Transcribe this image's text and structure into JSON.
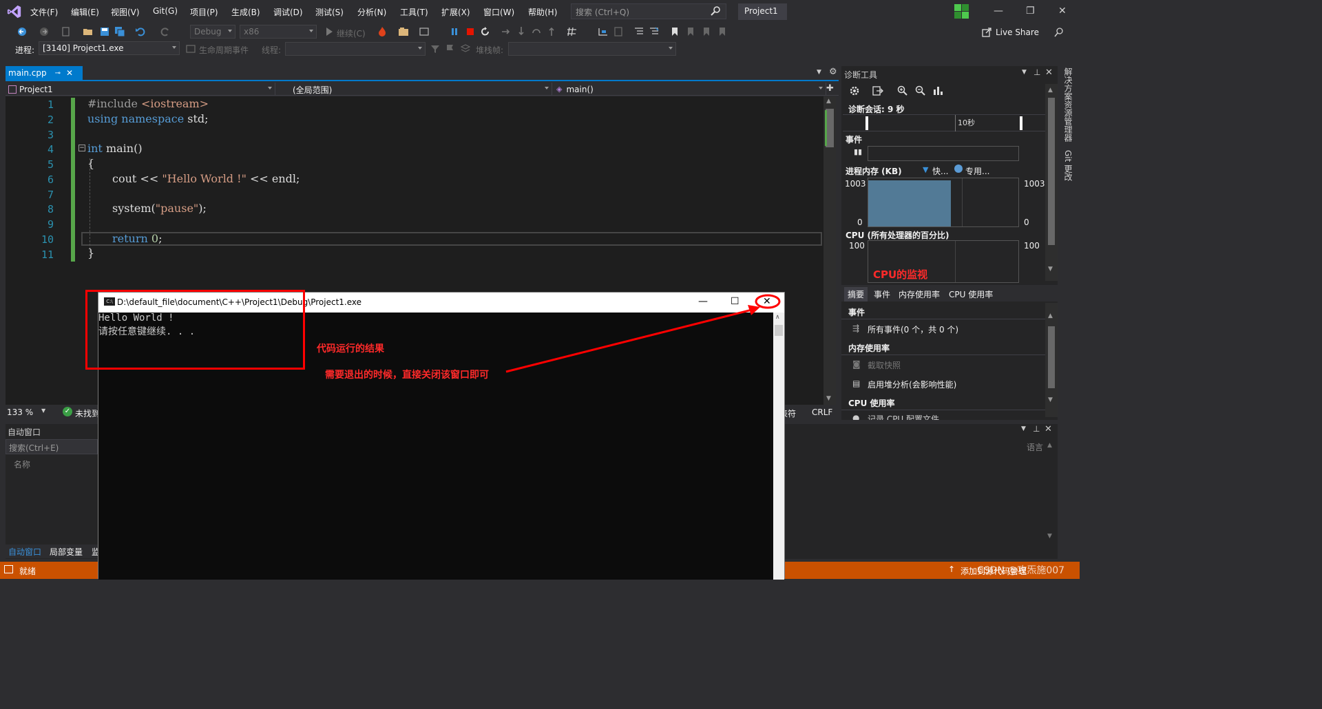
{
  "menubar": {
    "items": [
      "文件(F)",
      "编辑(E)",
      "视图(V)",
      "Git(G)",
      "项目(P)",
      "生成(B)",
      "调试(D)",
      "测试(S)",
      "分析(N)",
      "工具(T)",
      "扩展(X)",
      "窗口(W)",
      "帮助(H)"
    ],
    "search_placeholder": "搜索 (Ctrl+Q)",
    "project_name": "Project1",
    "window_controls": [
      "—",
      "❐",
      "✕"
    ]
  },
  "toolbar": {
    "config": "Debug",
    "platform": "x86",
    "continue_label": "继续(C)",
    "live_share": "Live Share",
    "process_label": "进程:",
    "process_value": "[3140] Project1.exe",
    "lifecycle_label": "生命周期事件",
    "thread_label": "线程:",
    "stackframe_label": "堆栈帧:"
  },
  "editor": {
    "tab_name": "main.cpp",
    "nav_project": "Project1",
    "nav_scope": "(全局范围)",
    "nav_member": "main()",
    "line_numbers": [
      "1",
      "2",
      "3",
      "4",
      "5",
      "6",
      "7",
      "8",
      "9",
      "10",
      "11"
    ],
    "code": {
      "l1_pp": "#include ",
      "l1_inc": "<iostream>",
      "l2_kw1": "using",
      "l2_kw2": "namespace",
      "l2_rest": " std;",
      "l4_kw": "int",
      "l4_rest": " main()",
      "l5": "{",
      "l6_a": "cout << ",
      "l6_str": "\"Hello World !\"",
      "l6_b": " << endl;",
      "l8_a": "system(",
      "l8_str": "\"pause\"",
      "l8_b": ");",
      "l10_kw": "return",
      "l10_num": " 0",
      "l10_b": ";",
      "l11": "}"
    },
    "zoom": "133 %",
    "issues": "未找到",
    "tab_chars": "制表符",
    "line_ending": "CRLF"
  },
  "diagnostics": {
    "title": "诊断工具",
    "session": "诊断会话: 9 秒",
    "timeline_label": "10秒",
    "events_header": "事件",
    "memory_header": "进程内存 (KB)",
    "memory_legend_snapshot": "快...",
    "memory_legend_private": "专用...",
    "memory_max_left": "1003",
    "memory_min_left": "0",
    "memory_max_right": "1003",
    "memory_min_right": "0",
    "memory_fill_fraction": 0.95,
    "cpu_header": "CPU (所有处理器的百分比)",
    "cpu_max_left": "100",
    "cpu_max_right": "100",
    "tabs": [
      "摘要",
      "事件",
      "内存使用率",
      "CPU 使用率"
    ],
    "sec_events": "事件",
    "all_events": "所有事件(0 个，共 0 个)",
    "sec_memory": "内存使用率",
    "take_snapshot": "截取快照",
    "heap_analysis": "启用堆分析(会影响性能)",
    "sec_cpu": "CPU 使用率",
    "cpu_profile_partial": "记录 CPU 配置文件"
  },
  "vertical_tabs": [
    "解决方案资源管理器",
    "Git 更改"
  ],
  "auto_panel": {
    "title": "自动窗口",
    "search": "搜索(Ctrl+E)",
    "col_name": "名称",
    "tabs": [
      "自动窗口",
      "局部变量",
      "监"
    ]
  },
  "output_panel": {
    "col_lang": "语言"
  },
  "statusbar": {
    "ready": "就绪",
    "add_source": "添加到源代码管理"
  },
  "console": {
    "title": "D:\\default_file\\document\\C++\\Project1\\Debug\\Project1.exe",
    "line1": "Hello World !",
    "line2": "请按任意键继续. . .",
    "controls": [
      "—",
      "☐",
      "✕"
    ]
  },
  "annotations": {
    "cpu_monitor": "CPU的监视",
    "code_result": "代码运行的结果",
    "close_hint": "需要退出的时候，直接关闭该窗口即可",
    "watermark": "CSDN @攻炁施007"
  },
  "colors": {
    "accent": "#007acc",
    "statusbar": "#ca5100",
    "annotation_red": "#ff0000"
  }
}
